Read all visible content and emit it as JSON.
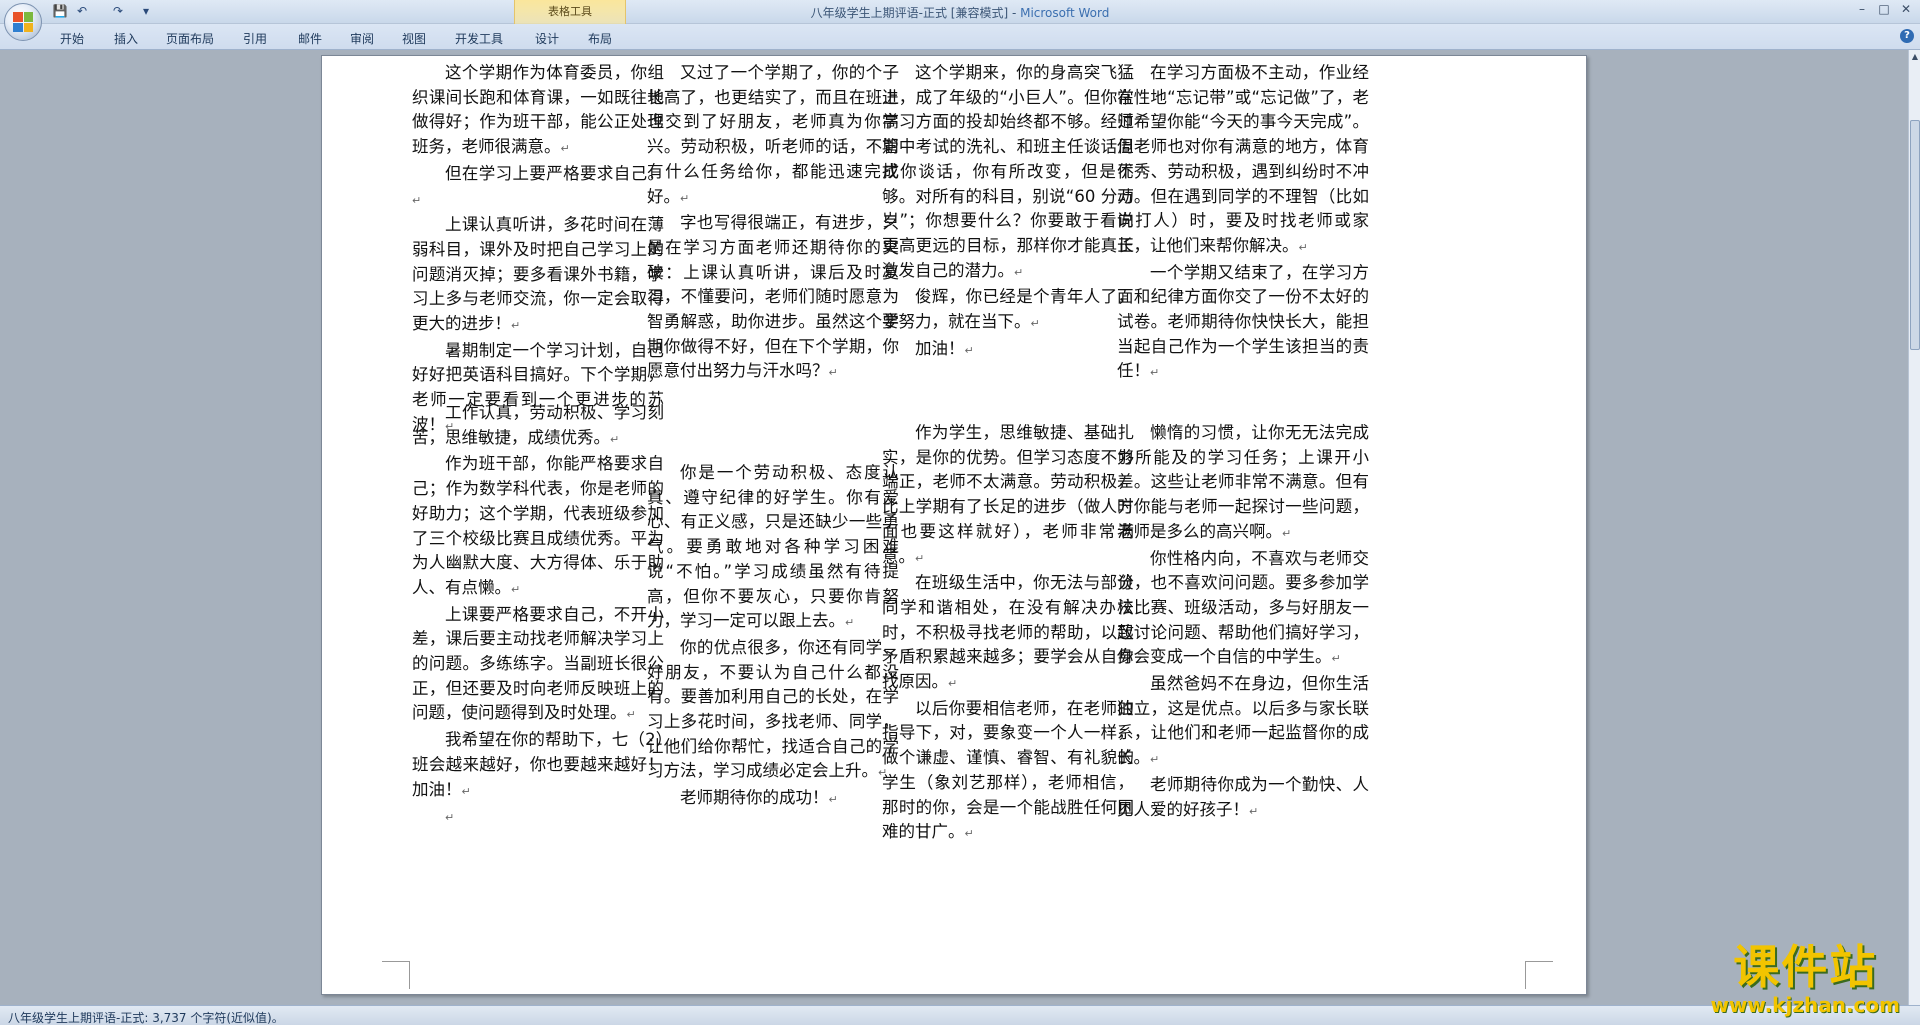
{
  "window": {
    "title_doc": "八年级学生上期评语-正式 [兼容模式] - ",
    "title_app": "Microsoft Word",
    "minimize": "–",
    "maximize": "□",
    "close": "✕"
  },
  "quick_access": {
    "save_icon": "save-icon",
    "undo_icon": "undo-icon",
    "redo_icon": "redo-icon",
    "more": "▾"
  },
  "ribbon": {
    "context_label": "表格工具",
    "tabs": [
      "开始",
      "插入",
      "页面布局",
      "引用",
      "邮件",
      "审阅",
      "视图",
      "开发工具",
      "设计",
      "布局"
    ],
    "help": "?"
  },
  "document": {
    "top": [
      [
        "这个学期作为体育委员，你组织课间长跑和体育课，一如既往地做得好；作为班干部，能公正处理班务，老师很满意。",
        "但在学习上要严格要求自己。",
        "上课认真听讲，多花时间在薄弱科目，课外及时把自己学习上的问题消灭掉；要多看课外书籍，学习上多与老师交流，你一定会取得更大的进步！",
        "暑期制定一个学习计划，自己好好把英语科目搞好。下个学期，老师一定要看到一个更进步的苏波！"
      ],
      [
        "又过了一个学期了，你的个子长高了，也更结实了，而且在班上也交到了好朋友，老师真为你高兴。劳动积极，听老师的话，不管有什么任务给你，都能迅速完成好。",
        "字也写得很端正，有进步，只是在学习方面老师还期待你的突破：上课认真听讲，课后及时复习，不懂要问，老师们随时愿意为智勇解惑，助你进步。虽然这个学期你做得不好，但在下个学期，你愿意付出努力与汗水吗？"
      ],
      [
        "这个学期来，你的身高突飞猛进，成了年级的“小巨人”。但你在学习方面的投却始终都不够。经过期中考试的洗礼、和班主任谈话周找你谈话，你有所改变，但是不够。对所有的科目，别说“60 分万岁”；你想要什么？你要敢于看向更高更远的目标，那样你才能真正激发自己的潜力。",
        "俊辉，你已经是个青年人了，要努力，就在当下。",
        "加油！"
      ],
      [
        "在学习方面极不主动，作业经常性地“忘记带”或“忘记做”了，老师希望你能“今天的事今天完成”。但老师也对你有满意的地方，体育优秀、劳动积极，遇到纠纷时不冲动。但在遇到同学的不理智（比如说打人）时，要及时找老师或家长，让他们来帮你解决。",
        "一个学期又结束了，在学习方面和纪律方面你交了一份不太好的试卷。老师期待你快快长大，能担当起自己作为一个学生该担当的责任！"
      ]
    ],
    "bottom": [
      [
        "工作认真，劳动积极、学习刻苦，思维敏捷，成绩优秀。",
        "作为班干部，你能严格要求自己；作为数学科代表，你是老师的好助力；这个学期，代表班级参加了三个校级比赛且成绩优秀。平为为人幽默大度、大方得体、乐于助人、有点懒。",
        "上课要严格要求自己，不开小差，课后要主动找老师解决学习上的问题。多练练字。当副班长很公正，但还要及时向老师反映班上的问题，使问题得到及时处理。",
        "我希望在你的帮助下，七（2）班会越来越好，你也要越来越好！加油！",
        ""
      ],
      [
        "你是一个劳动积极、态度认真、遵守纪律的好学生。你有爱心、有正义感，只是还缺少一些勇气。要勇敢地对各种学习困难说“不怕。”学习成绩虽然有待提高，但你不要灰心，只要你肯努力，学习一定可以跟上去。",
        "你的优点很多，你还有同学、好朋友，不要认为自己什么都没有。要善加利用自己的长处，在学习上多花时间，多找老师、同学，让他们给你帮忙，找适合自己的学习方法，学习成绩必定会上升。",
        "老师期待你的成功！"
      ],
      [
        "作为学生，思维敏捷、基础扎实，是你的优势。但学习态度不够端正，老师不太满意。劳动积极，比上学期有了长足的进步（做人方面也要这样就好），老师非常满意。",
        "在班级生活中，你无法与部分同学和谐相处，在没有解决办法时，不积极寻找老师的帮助，以致矛盾积累越来越多；要学会从自身找原因。",
        "以后你要相信老师，在老师的指导下，对，要象变一个人一样，做个谦虚、谨慎、睿智、有礼貌的学生（象刘艺那样），老师相信，那时的你，会是一个能战胜任何困难的甘广。"
      ],
      [
        "懒惰的习惯，让你无无法完成力所能及的学习任务；上课开小差。这些让老师非常不满意。但有时你能与老师一起探讨一些问题，老师是多么的高兴啊。",
        "你性格内向，不喜欢与老师交谈，也不喜欢问问题。要多参加学校比赛、班级活动，多与好朋友一起讨论问题、帮助他们搞好学习，你会变成一个自信的中学生。",
        "虽然爸妈不在身边，但你生活独立，这是优点。以后多与家长联系，让他们和老师一起监督你的成长。",
        "老师期待你成为一个勤快、人见人爱的好孩子！"
      ]
    ],
    "paragraph_mark": "↵"
  },
  "statusbar": {
    "text": "八年级学生上期评语-正式: 3,737 个字符(近似值)。"
  },
  "watermark": {
    "title": "课件站",
    "url": "www.kjzhan.com"
  }
}
